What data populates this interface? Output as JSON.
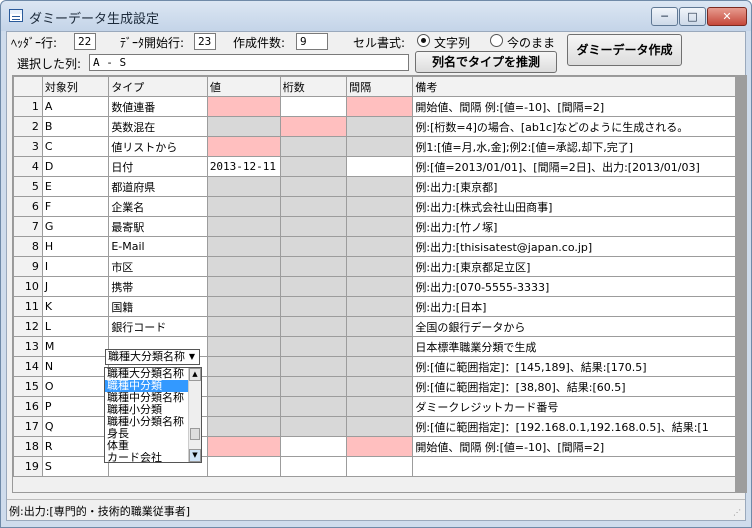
{
  "window": {
    "title": "ダミーデータ生成設定",
    "minimize": "─",
    "maximize": "□",
    "close": "✕"
  },
  "form": {
    "header_row_label": "ﾍｯﾀﾞｰ行:",
    "header_row_value": "22",
    "data_start_label": "ﾃﾞｰﾀ開始行:",
    "data_start_value": "23",
    "count_label": "作成件数:",
    "count_value": "9",
    "cell_format_label": "セル書式:",
    "radio_string": "文字列",
    "radio_asis": "今のまま",
    "selected_cols_label": "選択した列:",
    "selected_cols_value": "A - S",
    "infer_button": "列名でタイプを推測",
    "create_button": "ダミーデータ作成"
  },
  "grid": {
    "headers": [
      "対象列",
      "タイプ",
      "値",
      "桁数",
      "間隔",
      "備考"
    ],
    "rows": [
      {
        "n": "1",
        "col": "A",
        "type": "数値連番",
        "val": "",
        "digits": "",
        "interval": "",
        "note": "開始値、間隔 例:[値=-10]、[間隔=2]",
        "c3": "pink",
        "c4": "wh",
        "c5": "pink"
      },
      {
        "n": "2",
        "col": "B",
        "type": "英数混在",
        "val": "",
        "digits": "",
        "interval": "",
        "note": "例:[桁数=4]の場合、[ab1c]などのように生成される。",
        "c3": "gray",
        "c4": "pink",
        "c5": "gray"
      },
      {
        "n": "3",
        "col": "C",
        "type": "値リストから",
        "val": "",
        "digits": "",
        "interval": "",
        "note": "例1:[値=月,水,金];例2:[値=承認,却下,完了]",
        "c3": "pink",
        "c4": "gray",
        "c5": "gray"
      },
      {
        "n": "4",
        "col": "D",
        "type": "日付",
        "val": "2013-12-11",
        "digits": "",
        "interval": "",
        "note": "例:[値=2013/01/01]、[間隔=2日]、出力:[2013/01/03]",
        "c3": "wh",
        "c4": "gray",
        "c5": "wh"
      },
      {
        "n": "5",
        "col": "E",
        "type": "都道府県",
        "val": "",
        "digits": "",
        "interval": "",
        "note": "例:出力:[東京都]",
        "c3": "gray",
        "c4": "gray",
        "c5": "gray"
      },
      {
        "n": "6",
        "col": "F",
        "type": "企業名",
        "val": "",
        "digits": "",
        "interval": "",
        "note": "例:出力:[株式会社山田商事]",
        "c3": "gray",
        "c4": "gray",
        "c5": "gray"
      },
      {
        "n": "7",
        "col": "G",
        "type": "最寄駅",
        "val": "",
        "digits": "",
        "interval": "",
        "note": "例:出力:[竹ノ塚]",
        "c3": "gray",
        "c4": "gray",
        "c5": "gray"
      },
      {
        "n": "8",
        "col": "H",
        "type": "E-Mail",
        "val": "",
        "digits": "",
        "interval": "",
        "note": "例:出力:[thisisatest@japan.co.jp]",
        "c3": "gray",
        "c4": "gray",
        "c5": "gray"
      },
      {
        "n": "9",
        "col": "I",
        "type": "市区",
        "val": "",
        "digits": "",
        "interval": "",
        "note": "例:出力:[東京都足立区]",
        "c3": "gray",
        "c4": "gray",
        "c5": "gray"
      },
      {
        "n": "10",
        "col": "J",
        "type": "携帯",
        "val": "",
        "digits": "",
        "interval": "",
        "note": "例:出力:[070-5555-3333]",
        "c3": "gray",
        "c4": "gray",
        "c5": "gray"
      },
      {
        "n": "11",
        "col": "K",
        "type": "国籍",
        "val": "",
        "digits": "",
        "interval": "",
        "note": "例:出力:[日本]",
        "c3": "gray",
        "c4": "gray",
        "c5": "gray"
      },
      {
        "n": "12",
        "col": "L",
        "type": "銀行コード",
        "val": "",
        "digits": "",
        "interval": "",
        "note": "全国の銀行データから",
        "c3": "gray",
        "c4": "gray",
        "c5": "gray"
      },
      {
        "n": "13",
        "col": "M",
        "type": "",
        "val": "",
        "digits": "",
        "interval": "",
        "note": "日本標準職業分類で生成",
        "c3": "gray",
        "c4": "gray",
        "c5": "gray"
      },
      {
        "n": "14",
        "col": "N",
        "type": "",
        "val": "",
        "digits": "",
        "interval": "",
        "note": "例:[値に範囲指定]：[145,189]、結果:[170.5]",
        "c3": "gray",
        "c4": "gray",
        "c5": "gray"
      },
      {
        "n": "15",
        "col": "O",
        "type": "",
        "val": "",
        "digits": "",
        "interval": "",
        "note": "例:[値に範囲指定]：[38,80]、結果:[60.5]",
        "c3": "gray",
        "c4": "gray",
        "c5": "gray"
      },
      {
        "n": "16",
        "col": "P",
        "type": "",
        "val": "",
        "digits": "",
        "interval": "",
        "note": "ダミークレジットカード番号",
        "c3": "gray",
        "c4": "gray",
        "c5": "gray"
      },
      {
        "n": "17",
        "col": "Q",
        "type": "",
        "val": "",
        "digits": "",
        "interval": "",
        "note": "例:[値に範囲指定]：[192.168.0.1,192.168.0.5]、結果:[1",
        "c3": "gray",
        "c4": "gray",
        "c5": "gray"
      },
      {
        "n": "18",
        "col": "R",
        "type": "",
        "val": "",
        "digits": "",
        "interval": "",
        "note": "開始値、間隔 例:[値=-10]、[間隔=2]",
        "c3": "pink",
        "c4": "wh",
        "c5": "pink"
      },
      {
        "n": "19",
        "col": "S",
        "type": "",
        "val": "",
        "digits": "",
        "interval": "",
        "note": "",
        "c3": "wh",
        "c4": "wh",
        "c5": "wh"
      }
    ]
  },
  "combo": {
    "selected": "職種大分類名称",
    "options": [
      "職種大分類名称",
      "職種中分類",
      "職種中分類名称",
      "職種小分類",
      "職種小分類名称",
      "身長",
      "体重",
      "カード会社"
    ],
    "highlighted_index": 1
  },
  "status": {
    "text": "例:出力:[専門的・技術的職業従事者]"
  }
}
